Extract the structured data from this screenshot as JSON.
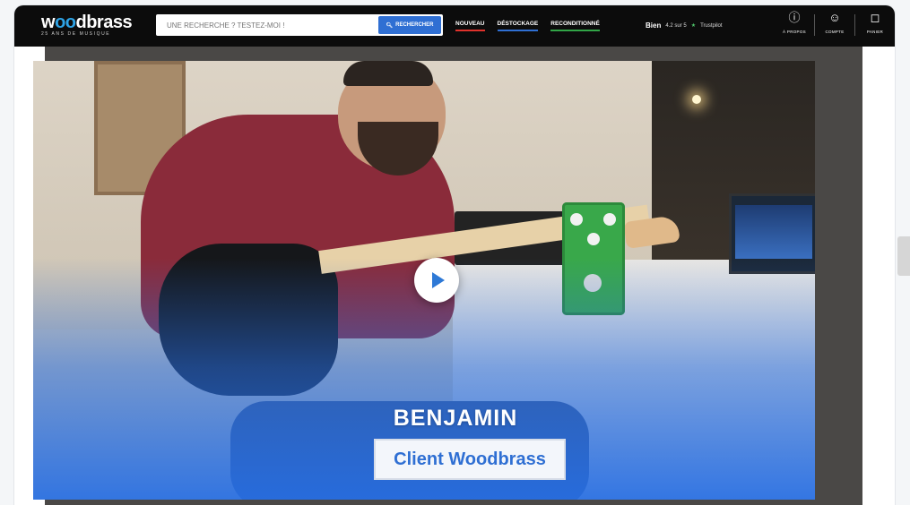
{
  "header": {
    "logo_text": "woodbrass",
    "logo_subtitle": "25 ANS DE MUSIQUE",
    "search": {
      "placeholder": "UNE RECHERCHE ? TESTEZ-MOI !",
      "button_label": "RECHERCHER"
    },
    "nav": [
      {
        "label": "NOUVEAU",
        "color": "#e0322c"
      },
      {
        "label": "DÉSTOCKAGE",
        "color": "#2f6fd3"
      },
      {
        "label": "RECONDITIONNÉ",
        "color": "#31a547"
      }
    ],
    "rating": {
      "label": "Bien",
      "score": "4.2 sur 5",
      "source": "Trustpilot"
    },
    "actions": [
      {
        "label": "À PROPOS",
        "icon": "info-icon"
      },
      {
        "label": "COMPTE",
        "icon": "account-icon"
      },
      {
        "label": "PANIER",
        "icon": "bag-icon"
      }
    ]
  },
  "video": {
    "person_name": "BENJAMIN",
    "person_role": "Client Woodbrass",
    "accent_color": "#2e79d6"
  }
}
